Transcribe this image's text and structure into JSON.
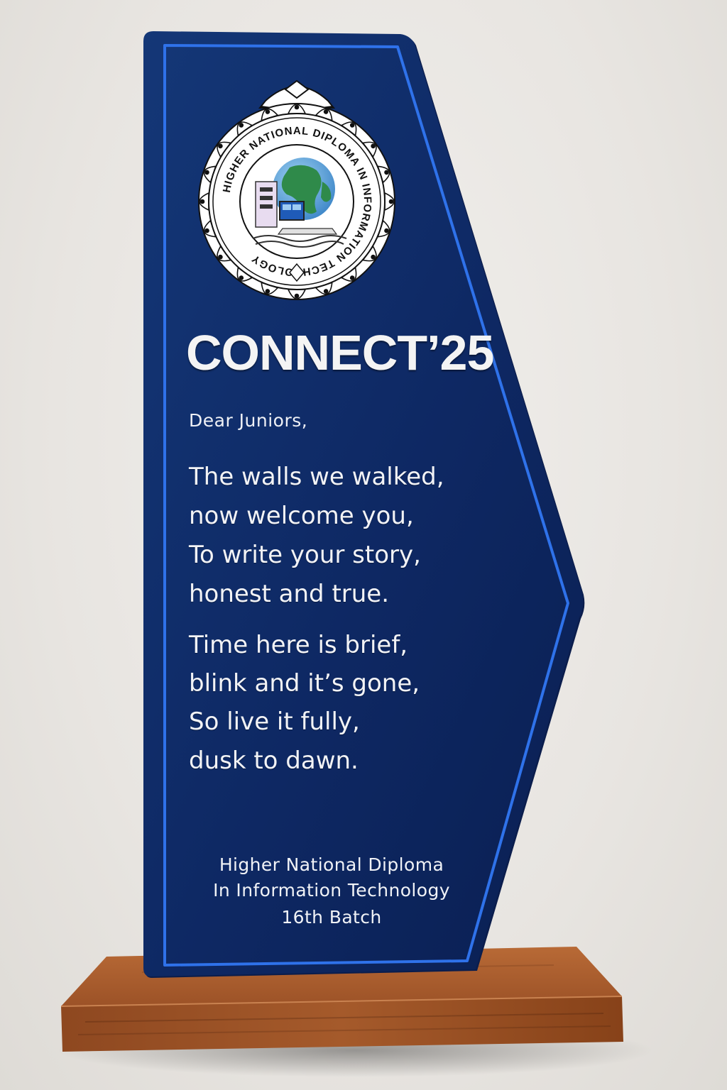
{
  "trophy": {
    "title": "CONNECT’25",
    "greeting": "Dear Juniors,",
    "stanzas": [
      [
        "The walls we walked,",
        "now welcome you,",
        "To write your story,",
        "honest and true."
      ],
      [
        "Time here is brief,",
        "blink and it’s gone,",
        "So live it fully,",
        "dusk to dawn."
      ]
    ],
    "footer": [
      "Higher National Diploma",
      "In Information Technology",
      "16th Batch"
    ]
  },
  "logo": {
    "ring_text": "HIGHER NATIONAL DIPLOMA IN INFORMATION TECHNOLOGY"
  },
  "colors": {
    "plaque_navy": "#0f2a66",
    "plaque_edge": "#2d6ee6",
    "wood_base": "#a6582a",
    "background": "#ebe8e4"
  }
}
